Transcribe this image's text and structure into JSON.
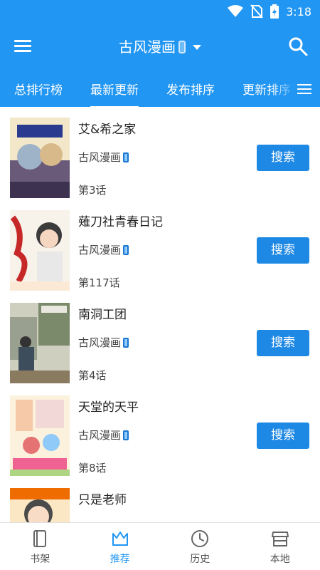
{
  "status_bar": {
    "time": "3:18",
    "icons": [
      "wifi-icon",
      "no-sim-icon",
      "battery-charging-icon"
    ]
  },
  "toolbar": {
    "menu_icon": "menu-icon",
    "source_title": "古风漫画",
    "search_icon": "search-icon"
  },
  "tabs": [
    {
      "label": "总排行榜",
      "active": false
    },
    {
      "label": "最新更新",
      "active": true
    },
    {
      "label": "发布排序",
      "active": false
    },
    {
      "label": "更新排序",
      "active": false
    }
  ],
  "items": [
    {
      "name": "艾&希之家",
      "source": "古风漫画",
      "chapter": "第3话",
      "button": "搜索"
    },
    {
      "name": "薙刀社青春日记",
      "source": "古风漫画",
      "chapter": "第117话",
      "button": "搜索"
    },
    {
      "name": "南洞工团",
      "source": "古风漫画",
      "chapter": "第4话",
      "button": "搜索"
    },
    {
      "name": "天堂的天平",
      "source": "古风漫画",
      "chapter": "第8话",
      "button": "搜索"
    },
    {
      "name": "只是老师",
      "source": "",
      "chapter": "",
      "button": ""
    }
  ],
  "bottom_nav": [
    {
      "label": "书架",
      "icon": "book-icon",
      "active": false
    },
    {
      "label": "推荐",
      "icon": "crown-icon",
      "active": true
    },
    {
      "label": "历史",
      "icon": "clock-icon",
      "active": false
    },
    {
      "label": "本地",
      "icon": "store-icon",
      "active": false
    }
  ],
  "colors": {
    "primary": "#2196f3",
    "button": "#1e88e5",
    "text": "#222222"
  }
}
